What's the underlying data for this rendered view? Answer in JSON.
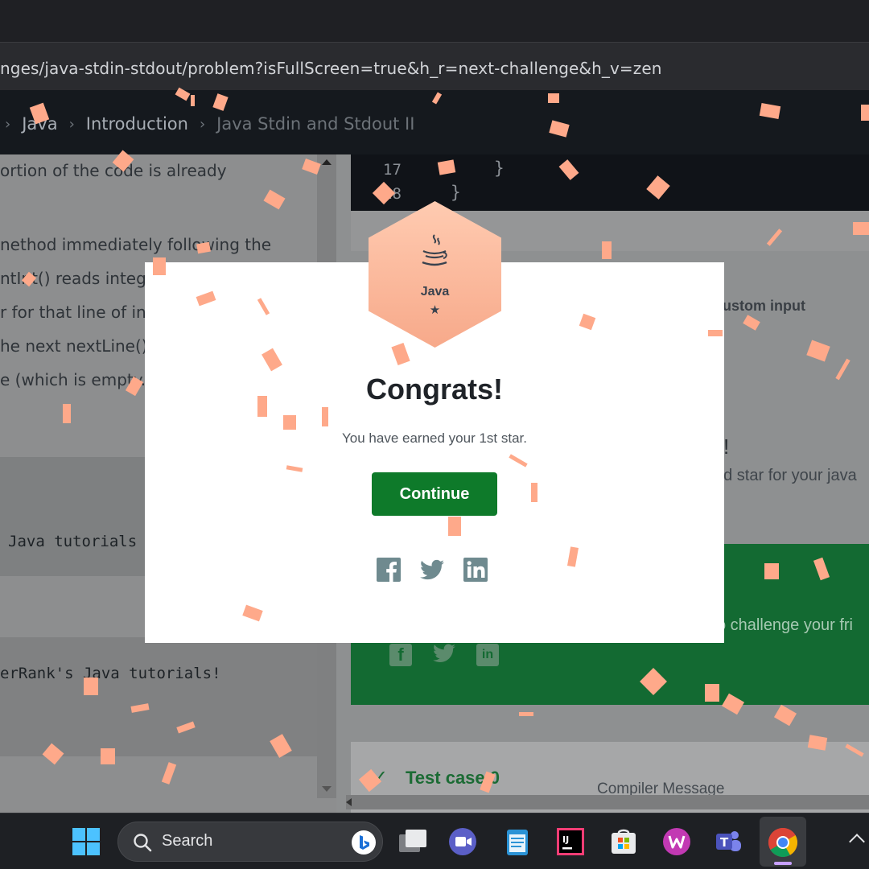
{
  "browser": {
    "url": "nges/java-stdin-stdout/problem?isFullScreen=true&h_r=next-challenge&h_v=zen"
  },
  "breadcrumb": {
    "items": [
      "Java",
      "Introduction",
      "Java Stdin and Stdout II"
    ]
  },
  "problem": {
    "lines": [
      "ortion of the code is already",
      "nethod immediately following the",
      "ntInt() reads integer",
      "r for that line of int",
      "he next nextLine()",
      "e (which is empty."
    ],
    "code_sample_1": "Java tutorials",
    "code_sample_2": "erRank's Java tutorials!"
  },
  "editor": {
    "line_numbers": [
      "17",
      "18"
    ],
    "braces": [
      "}",
      "}"
    ]
  },
  "right": {
    "custom_input_label": "ustom input",
    "partial_heading": "s!",
    "partial_star_text": "nd star for your java",
    "partial_challenge_text": "o challenge your fri",
    "test_case_label": "Test case 0",
    "compiler_message": "Compiler Message"
  },
  "modal": {
    "badge_language": "Java",
    "badge_star": "★",
    "title": "Congrats!",
    "message": "You have earned your 1st star.",
    "continue_label": "Continue",
    "social_icons": [
      "facebook-icon",
      "twitter-icon",
      "linkedin-icon"
    ]
  },
  "taskbar": {
    "search_placeholder": "Search",
    "apps": [
      "windows-start-icon",
      "task-view-icon",
      "video-chat-icon",
      "notepad-icon",
      "intellij-idea-icon",
      "microsoft-store-icon",
      "wps-office-icon",
      "teams-icon",
      "chrome-icon"
    ]
  },
  "colors": {
    "accent_green": "#0e7a2a",
    "badge_peach": "#f7a98a",
    "confetti": "#fea98a"
  }
}
